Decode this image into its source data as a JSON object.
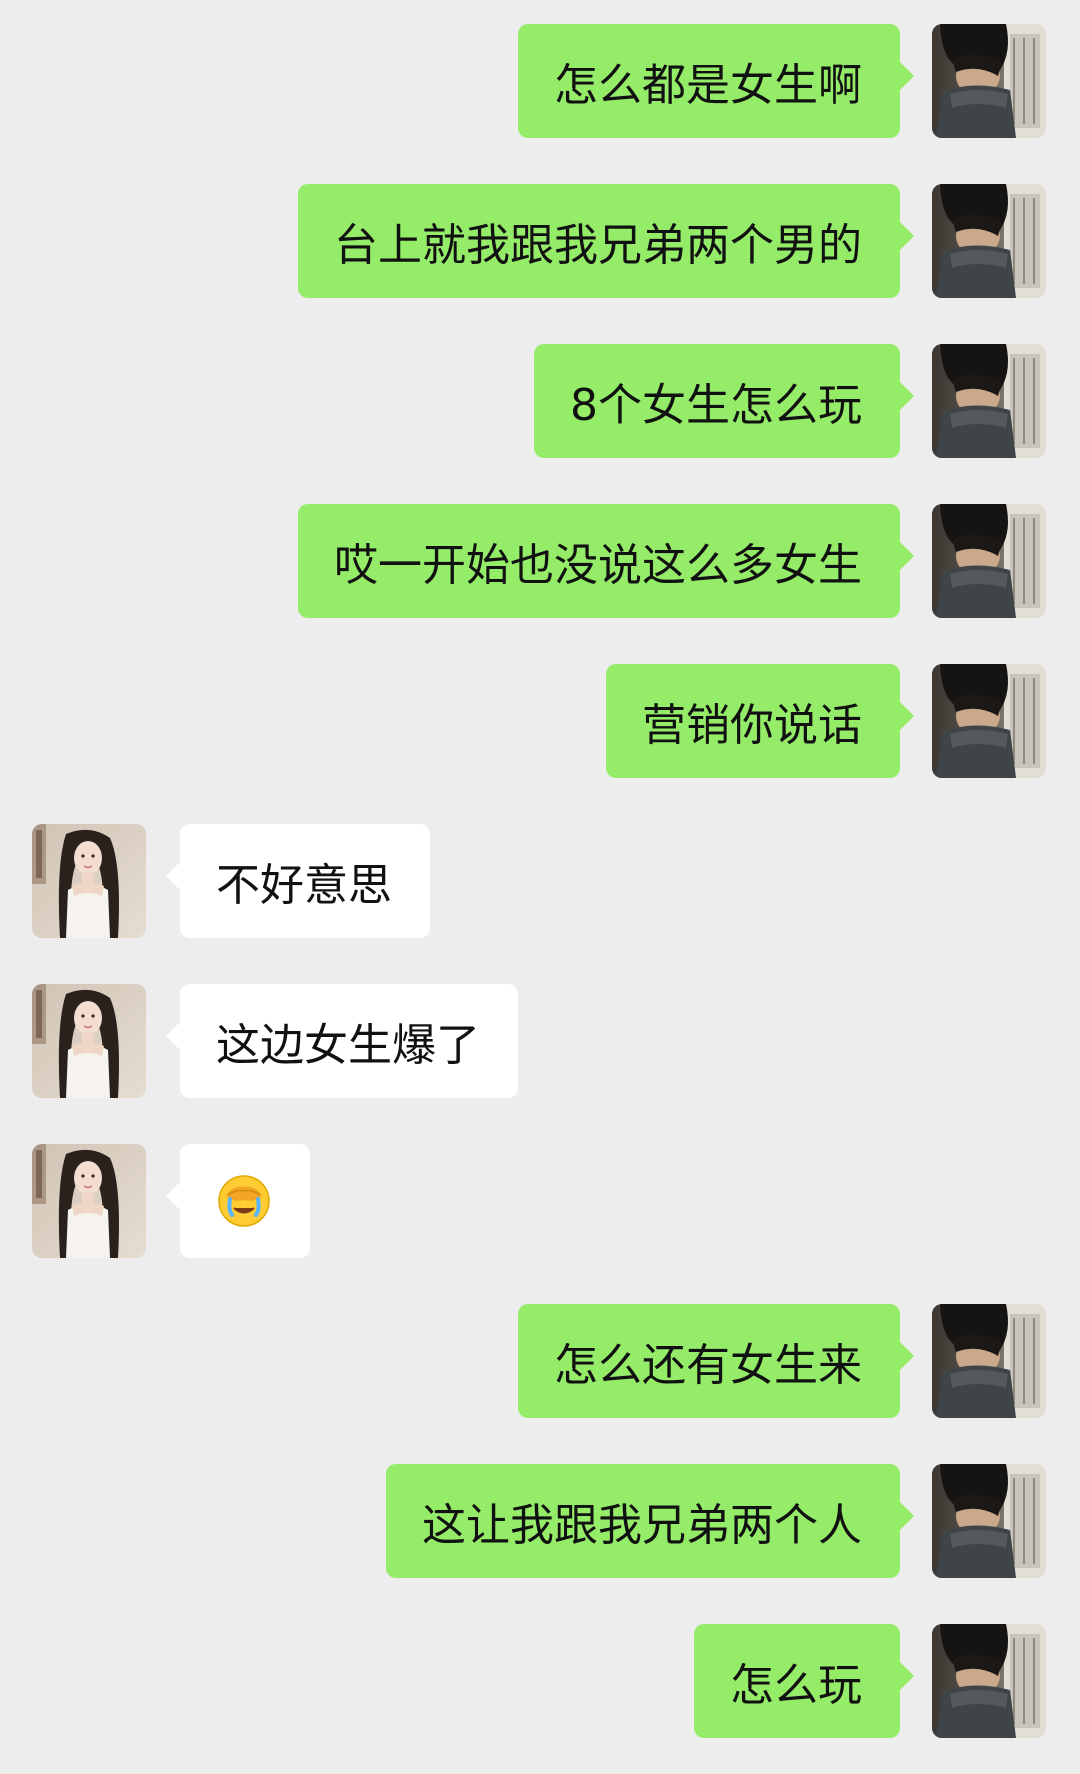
{
  "chat": {
    "messages": [
      {
        "side": "right",
        "kind": "text",
        "text": "怎么都是女生啊"
      },
      {
        "side": "right",
        "kind": "text",
        "text": "台上就我跟我兄弟两个男的"
      },
      {
        "side": "right",
        "kind": "text",
        "text": "8个女生怎么玩"
      },
      {
        "side": "right",
        "kind": "text",
        "text": "哎一开始也没说这么多女生"
      },
      {
        "side": "right",
        "kind": "text",
        "text": "营销你说话"
      },
      {
        "side": "left",
        "kind": "text",
        "text": "不好意思"
      },
      {
        "side": "left",
        "kind": "text",
        "text": "这边女生爆了"
      },
      {
        "side": "left",
        "kind": "emoji",
        "emoji": "facepalm-crying-emoji"
      },
      {
        "side": "right",
        "kind": "text",
        "text": "怎么还有女生来"
      },
      {
        "side": "right",
        "kind": "text",
        "text": "这让我跟我兄弟两个人"
      },
      {
        "side": "right",
        "kind": "text",
        "text": "怎么玩"
      }
    ]
  },
  "colors": {
    "background": "#ededed",
    "self_bubble": "#95ec69",
    "other_bubble": "#ffffff",
    "text": "#111111"
  },
  "icons": {
    "self_avatar": "boy-avatar",
    "other_avatar": "girl-avatar"
  }
}
